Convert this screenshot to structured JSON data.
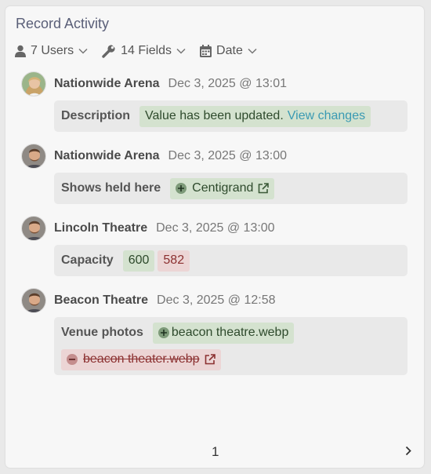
{
  "panel": {
    "title": "Record Activity"
  },
  "filters": {
    "users": "7 Users",
    "fields": "14 Fields",
    "date": "Date"
  },
  "entries": [
    {
      "user": "Nationwide Arena",
      "time": "Dec 3, 2025 @ 13:01",
      "field": "Description",
      "change_text": "Value has been updated.",
      "link": "View changes"
    },
    {
      "user": "Nationwide Arena",
      "time": "Dec 3, 2025 @ 13:00",
      "field": "Shows held here",
      "added": "Centigrand"
    },
    {
      "user": "Lincoln Theatre",
      "time": "Dec 3, 2025 @ 13:00",
      "field": "Capacity",
      "new_value": "600",
      "old_value": "582"
    },
    {
      "user": "Beacon Theatre",
      "time": "Dec 3, 2025 @ 12:58",
      "field": "Venue photos",
      "added": "beacon theatre.webp",
      "removed": "beacon theater.webp"
    }
  ],
  "pager": {
    "page": "1"
  },
  "colors": {
    "added_bg": "#d4e2cf",
    "removed_bg": "#ecd5d5",
    "link": "#3a9ab3",
    "title": "#5a5f78"
  }
}
